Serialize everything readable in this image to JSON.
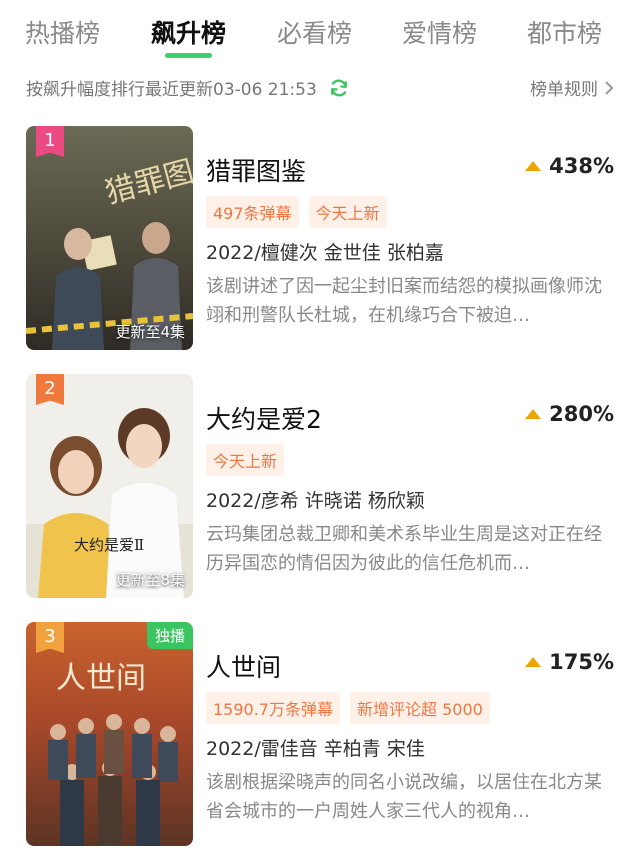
{
  "tabs": [
    {
      "label": "热播榜"
    },
    {
      "label": "飙升榜"
    },
    {
      "label": "必看榜"
    },
    {
      "label": "爱情榜"
    },
    {
      "label": "都市榜"
    }
  ],
  "active_tab": 1,
  "accent_color": "#3bd16f",
  "subheader": {
    "info": "按飙升幅度排行最近更新03-06 21:53",
    "refresh_icon": "refresh-icon",
    "rules_label": "榜单规则",
    "rules_icon": "chevron-right-icon"
  },
  "items": [
    {
      "rank": "1",
      "rank_color": "#ec4a82",
      "title": "猎罪图鉴",
      "growth": "438%",
      "tags": [
        "497条弹幕",
        "今天上新"
      ],
      "meta": "2022/檀健次 金世佳 张柏嘉",
      "description": "该剧讲述了因一起尘封旧案而结怨的模拟画像师沈翊和刑警队长杜城，在机缘巧合下被迫…",
      "poster_update": "更新至4集",
      "poster_text": "猎罪图鉴"
    },
    {
      "rank": "2",
      "rank_color": "#f07a3d",
      "title": "大约是爱2",
      "growth": "280%",
      "tags": [
        "今天上新"
      ],
      "meta": "2022/彦希 许晓诺 杨欣颖",
      "description": "云玛集团总裁卫卿和美术系毕业生周是这对正在经历异国恋的情侣因为彼此的信任危机而…",
      "poster_update": "更新至8集",
      "poster_text": "大约是爱Ⅱ"
    },
    {
      "rank": "3",
      "rank_color": "#f2a23c",
      "title": "人世间",
      "growth": "175%",
      "tags": [
        "1590.7万条弹幕",
        "新增评论超 5000"
      ],
      "meta": "2022/雷佳音 辛柏青 宋佳",
      "description": "该剧根据梁晓声的同名小说改编，以居住在北方某省会城市的一户周姓人家三代人的视角…",
      "poster_badge": "独播",
      "poster_text": "人世间"
    }
  ]
}
